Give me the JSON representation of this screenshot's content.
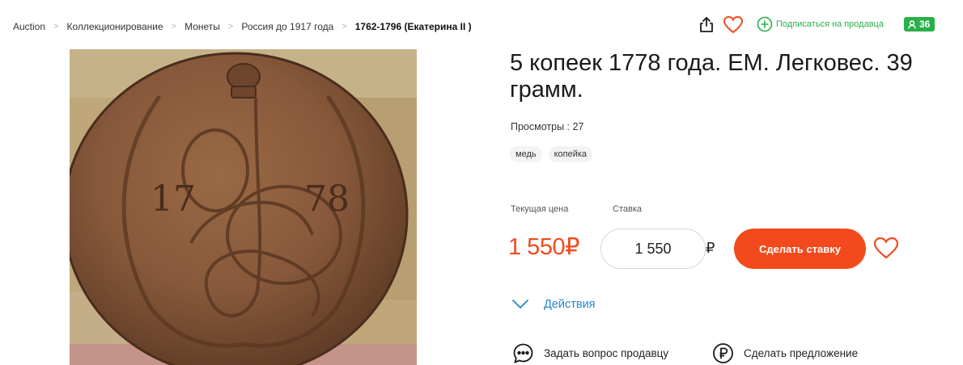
{
  "breadcrumb": [
    {
      "label": "Auction"
    },
    {
      "label": "Коллекционирование"
    },
    {
      "label": "Монеты"
    },
    {
      "label": "Россия до 1917 года"
    },
    {
      "label": "1762-1796 (Екатерина II )"
    }
  ],
  "breadcrumb_separator": ">",
  "header": {
    "share_icon": "share-icon",
    "favorite_icon": "heart-icon",
    "subscribe_label": "Подписаться на продавца",
    "subscriber_count": "36",
    "accent_green": "#2ab04a"
  },
  "product": {
    "title": "5 копеек 1778 года. ЕМ. Легковес. 39 грамм.",
    "views": "Просмотры : 27",
    "tags": [
      "медь",
      "копейка"
    ],
    "coin_year_left": "17",
    "coin_year_right": "78"
  },
  "bidding": {
    "current_price_label": "Текущая цена",
    "bid_label": "Ставка",
    "current_price": "1 550₽",
    "bid_value": "1 550",
    "bid_currency": "₽",
    "bid_button": "Сделать ставку",
    "accent_color": "#f24a1d"
  },
  "actions": {
    "label": "Действия",
    "ask_seller": "Задать вопрос продавцу",
    "make_offer": "Сделать предложение",
    "link_color": "#1f87c9"
  }
}
